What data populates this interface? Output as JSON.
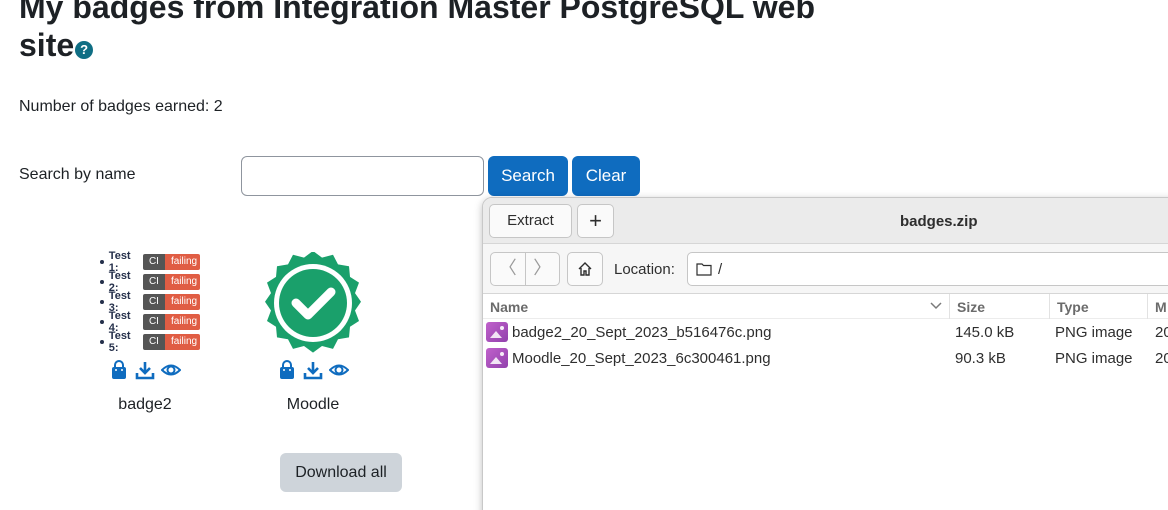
{
  "page": {
    "title": "My badges from Integration Master PostgreSQL web site",
    "help_icon_glyph": "?",
    "badge_count_text": "Number of badges earned: 2"
  },
  "search": {
    "label": "Search by name",
    "value": "",
    "placeholder": "",
    "search_button": "Search",
    "clear_button": "Clear"
  },
  "badges": [
    {
      "name": "badge2",
      "tests": [
        {
          "label": "Test 1:",
          "shield_left": "CI",
          "shield_right": "failing"
        },
        {
          "label": "Test 2:",
          "shield_left": "CI",
          "shield_right": "failing"
        },
        {
          "label": "Test 3:",
          "shield_left": "CI",
          "shield_right": "failing"
        },
        {
          "label": "Test 4:",
          "shield_left": "CI",
          "shield_right": "failing"
        },
        {
          "label": "Test 5:",
          "shield_left": "CI",
          "shield_right": "failing"
        }
      ],
      "actions": [
        "backpack-icon",
        "download-icon",
        "view-icon"
      ]
    },
    {
      "name": "Moodle",
      "image_icon": "check-seal-icon",
      "actions": [
        "backpack-icon",
        "download-icon",
        "view-icon"
      ]
    }
  ],
  "download_all_label": "Download all",
  "archive": {
    "title": "badges.zip",
    "extract_label": "Extract",
    "add_glyph": "+",
    "back_glyph": "〈",
    "forward_glyph": "〉",
    "location_label": "Location:",
    "location_path": "/",
    "columns": {
      "name": "Name",
      "size": "Size",
      "type": "Type",
      "modified": "M"
    },
    "files": [
      {
        "name": "badge2_20_Sept_2023_b516476c.png",
        "size": "145.0 kB",
        "type": "PNG image",
        "modified": "20"
      },
      {
        "name": "Moodle_20_Sept_2023_6c300461.png",
        "size": "90.3 kB",
        "type": "PNG image",
        "modified": "20"
      }
    ]
  },
  "colors": {
    "primary": "#0f6cbf",
    "secondary": "#ced4da",
    "badge_green": "#1aa06b",
    "shield_failing": "#e05d44"
  }
}
